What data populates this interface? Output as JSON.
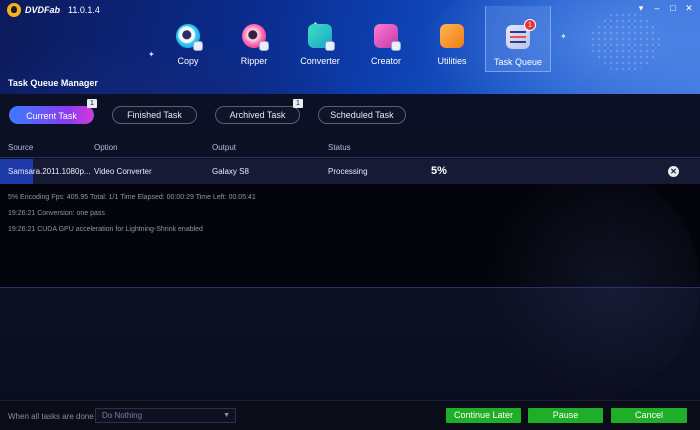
{
  "app": {
    "logo": "DVDFab",
    "version": "11.0.1.4"
  },
  "nav": [
    {
      "label": "Copy",
      "icon": "copy-disc-icon"
    },
    {
      "label": "Ripper",
      "icon": "ripper-disc-icon"
    },
    {
      "label": "Converter",
      "icon": "converter-icon"
    },
    {
      "label": "Creator",
      "icon": "creator-icon"
    },
    {
      "label": "Utilities",
      "icon": "utilities-icon"
    },
    {
      "label": "Task Queue",
      "icon": "task-queue-icon",
      "active": true,
      "badge": "1"
    }
  ],
  "page_title": "Task Queue Manager",
  "task_tabs": [
    {
      "label": "Current Task",
      "active": true,
      "count": "1"
    },
    {
      "label": "Finished Task"
    },
    {
      "label": "Archived Task",
      "count": "1"
    },
    {
      "label": "Scheduled Task"
    }
  ],
  "table": {
    "headers": {
      "source": "Source",
      "option": "Option",
      "output": "Output",
      "status": "Status"
    },
    "row": {
      "source": "Samsara.2011.1080p...",
      "option": "Video Converter",
      "output": "Galaxy S8",
      "status": "Processing",
      "progress": "5%"
    }
  },
  "log": [
    "5%  Encoding Fps: 405.95   Total: 1/1  Time Elapsed: 00:00:29  Time Left: 00:05:41",
    "19:26:21    Conversion: one pass",
    "19:26:21    CUDA GPU acceleration for Lightning-Shrink enabled"
  ],
  "footer": {
    "when_done_label": "When all tasks are done",
    "when_done_value": "Do Nothing",
    "continue_later": "Continue Later",
    "pause": "Pause",
    "cancel": "Cancel"
  },
  "colors": {
    "accent_green": "#1fae28",
    "active_blue": "#1d3aa8"
  }
}
